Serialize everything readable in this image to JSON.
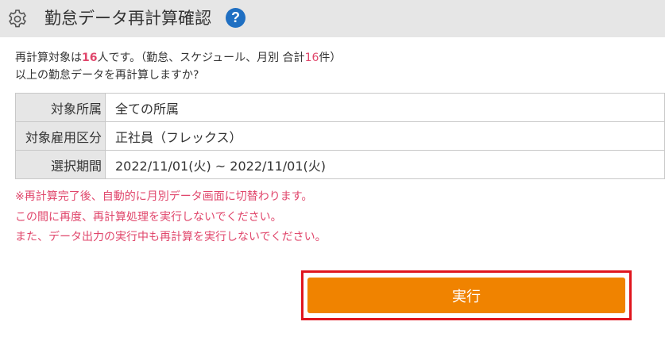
{
  "header": {
    "title": "勤怠データ再計算確認",
    "help_symbol": "?"
  },
  "description": {
    "prefix": "再計算対象は",
    "target_count": "16",
    "mid": "人です。（勤怠、スケジュール、月別 合計",
    "total_count": "16",
    "suffix": "件）",
    "line2": "以上の勤怠データを再計算しますか?"
  },
  "info_rows": [
    {
      "label": "対象所属",
      "value": "全ての所属"
    },
    {
      "label": "対象雇用区分",
      "value": "正社員（フレックス）"
    },
    {
      "label": "選択期間",
      "value": "2022/11/01(火) ~ 2022/11/01(火)"
    }
  ],
  "notes": [
    "※再計算完了後、自動的に月別データ画面に切替わります。",
    "この間に再度、再計算処理を実行しないでください。",
    "また、データ出力の実行中も再計算を実行しないでください。"
  ],
  "actions": {
    "execute_label": "実行"
  },
  "colors": {
    "header_bg": "#e6e6e6",
    "help_blue": "#1f6fc2",
    "highlight_pink": "#e0466b",
    "execute_orange": "#f08300",
    "highlight_frame_red": "#e0151e"
  }
}
